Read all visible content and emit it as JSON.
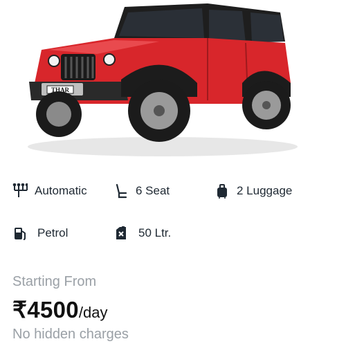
{
  "car": {
    "image_alt": "Red SUV",
    "plate_text": "THAR"
  },
  "specs": [
    {
      "icon": "transmission-icon",
      "label": "Automatic"
    },
    {
      "icon": "seat-icon",
      "label": "6 Seat"
    },
    {
      "icon": "luggage-icon",
      "label": "2 Luggage"
    },
    {
      "icon": "fuel-pump-icon",
      "label": "Petrol"
    },
    {
      "icon": "fuel-can-icon",
      "label": "50 Ltr."
    }
  ],
  "pricing": {
    "starting_label": "Starting From",
    "amount": "₹4500",
    "unit": "/day",
    "note": "No hidden charges"
  },
  "colors": {
    "car_body": "#d8262b",
    "tire": "#1b1b1b",
    "muted_text": "#9aa0a6",
    "icon": "#1f2933"
  }
}
